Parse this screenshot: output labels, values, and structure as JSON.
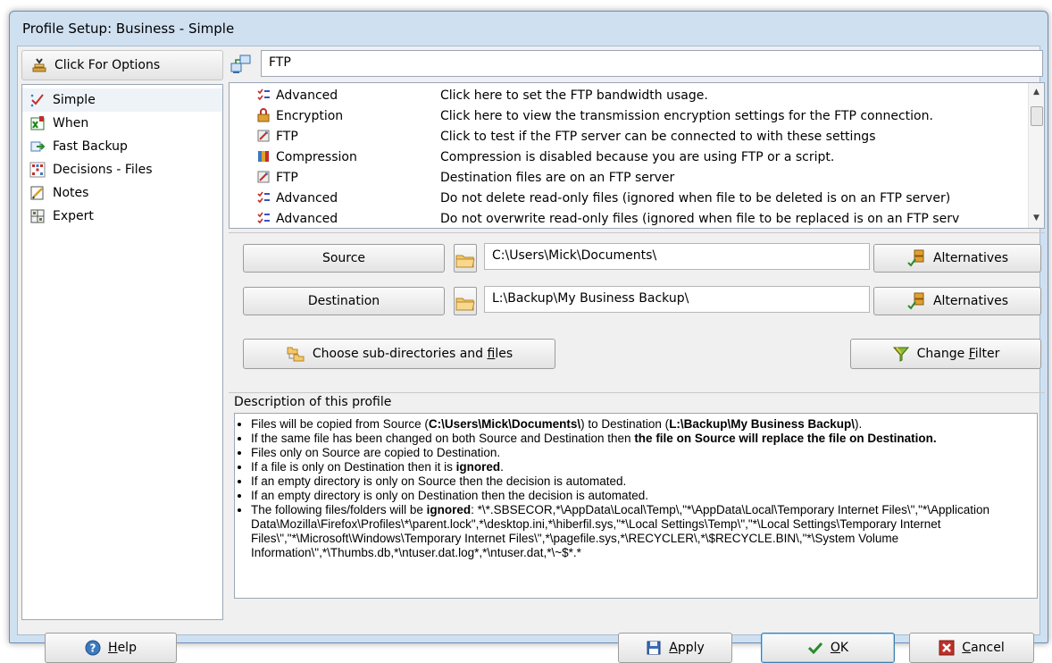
{
  "window": {
    "title": "Profile Setup: Business - Simple"
  },
  "sidebar": {
    "options_label": "Click For Options",
    "items": [
      {
        "label": "Simple",
        "icon": "checkmark-icon"
      },
      {
        "label": "When",
        "icon": "calendar-icon"
      },
      {
        "label": "Fast Backup",
        "icon": "fast-backup-icon"
      },
      {
        "label": "Decisions - Files",
        "icon": "decision-grid-icon"
      },
      {
        "label": "Notes",
        "icon": "notes-icon"
      },
      {
        "label": "Expert",
        "icon": "expert-grid-icon"
      }
    ]
  },
  "ftp": {
    "value": "FTP"
  },
  "settings": [
    {
      "name": "Advanced",
      "desc": "Click here to set the FTP bandwidth usage.",
      "icon": "advanced-icon"
    },
    {
      "name": "Encryption",
      "desc": "Click here to view the transmission encryption settings for the FTP connection.",
      "icon": "lock-icon"
    },
    {
      "name": "FTP",
      "desc": "Click to test if the FTP server can be connected to with these settings",
      "icon": "ftp-icon"
    },
    {
      "name": "Compression",
      "desc": "Compression is disabled because you are using FTP or a script.",
      "icon": "compression-icon"
    },
    {
      "name": "FTP",
      "desc": "Destination files are on an FTP server",
      "icon": "ftp-icon"
    },
    {
      "name": "Advanced",
      "desc": "Do not delete read-only files (ignored when file to be deleted is on an FTP server)",
      "icon": "advanced-icon"
    },
    {
      "name": "Advanced",
      "desc": "Do not overwrite read-only files (ignored when file to be replaced is on an FTP serv",
      "icon": "advanced-icon"
    }
  ],
  "paths": {
    "source_label": "Source",
    "source_value": "C:\\Users\\Mick\\Documents\\",
    "destination_label": "Destination",
    "destination_value": "L:\\Backup\\My Business Backup\\",
    "alternatives_label": "Alternatives"
  },
  "buttons": {
    "choose_subdirs": {
      "pre": "Choose sub-directories and ",
      "key": "f",
      "post": "iles"
    },
    "change_filter": {
      "pre": "Change ",
      "key": "F",
      "post": "ilter"
    },
    "help": {
      "key": "H",
      "post": "elp"
    },
    "apply": {
      "key": "A",
      "post": "pply"
    },
    "ok": {
      "key": "O",
      "post": "K"
    },
    "cancel": {
      "key": "C",
      "post": "ancel"
    }
  },
  "description": {
    "label": "Description of this profile",
    "l1_pre": "Files will be copied from Source (",
    "l1_src": "C:\\Users\\Mick\\Documents\\",
    "l1_mid": ") to Destination (",
    "l1_dst": "L:\\Backup\\My Business Backup\\",
    "l1_post": ").",
    "l2_pre": "If the same file has been changed on both Source and Destination then ",
    "l2_bold": "the file on Source will replace the file on Destination.",
    "l3": "Files only on Source are copied to Destination.",
    "l4_pre": "If a file is only on Destination then it is ",
    "l4_bold": "ignored",
    "l4_post": ".",
    "l5": "If an empty directory is only on Source then the decision is automated.",
    "l6": "If an empty directory is only on Destination then the decision is automated.",
    "l7_pre": "The following files/folders will be ",
    "l7_bold": "ignored",
    "l7_post": ": *\\*.SBSECOR,*\\AppData\\Local\\Temp\\,\"*\\AppData\\Local\\Temporary Internet Files\\\",\"*\\Application Data\\Mozilla\\Firefox\\Profiles\\*\\parent.lock\",*\\desktop.ini,*\\hiberfil.sys,\"*\\Local Settings\\Temp\\\",\"*\\Local Settings\\Temporary Internet Files\\\",\"*\\Microsoft\\Windows\\Temporary Internet Files\\\",*\\pagefile.sys,*\\RECYCLER\\,*\\$RECYCLE.BIN\\,\"*\\System Volume Information\\\",*\\Thumbs.db,*\\ntuser.dat.log*,*\\ntuser.dat,*\\~$*.*"
  }
}
